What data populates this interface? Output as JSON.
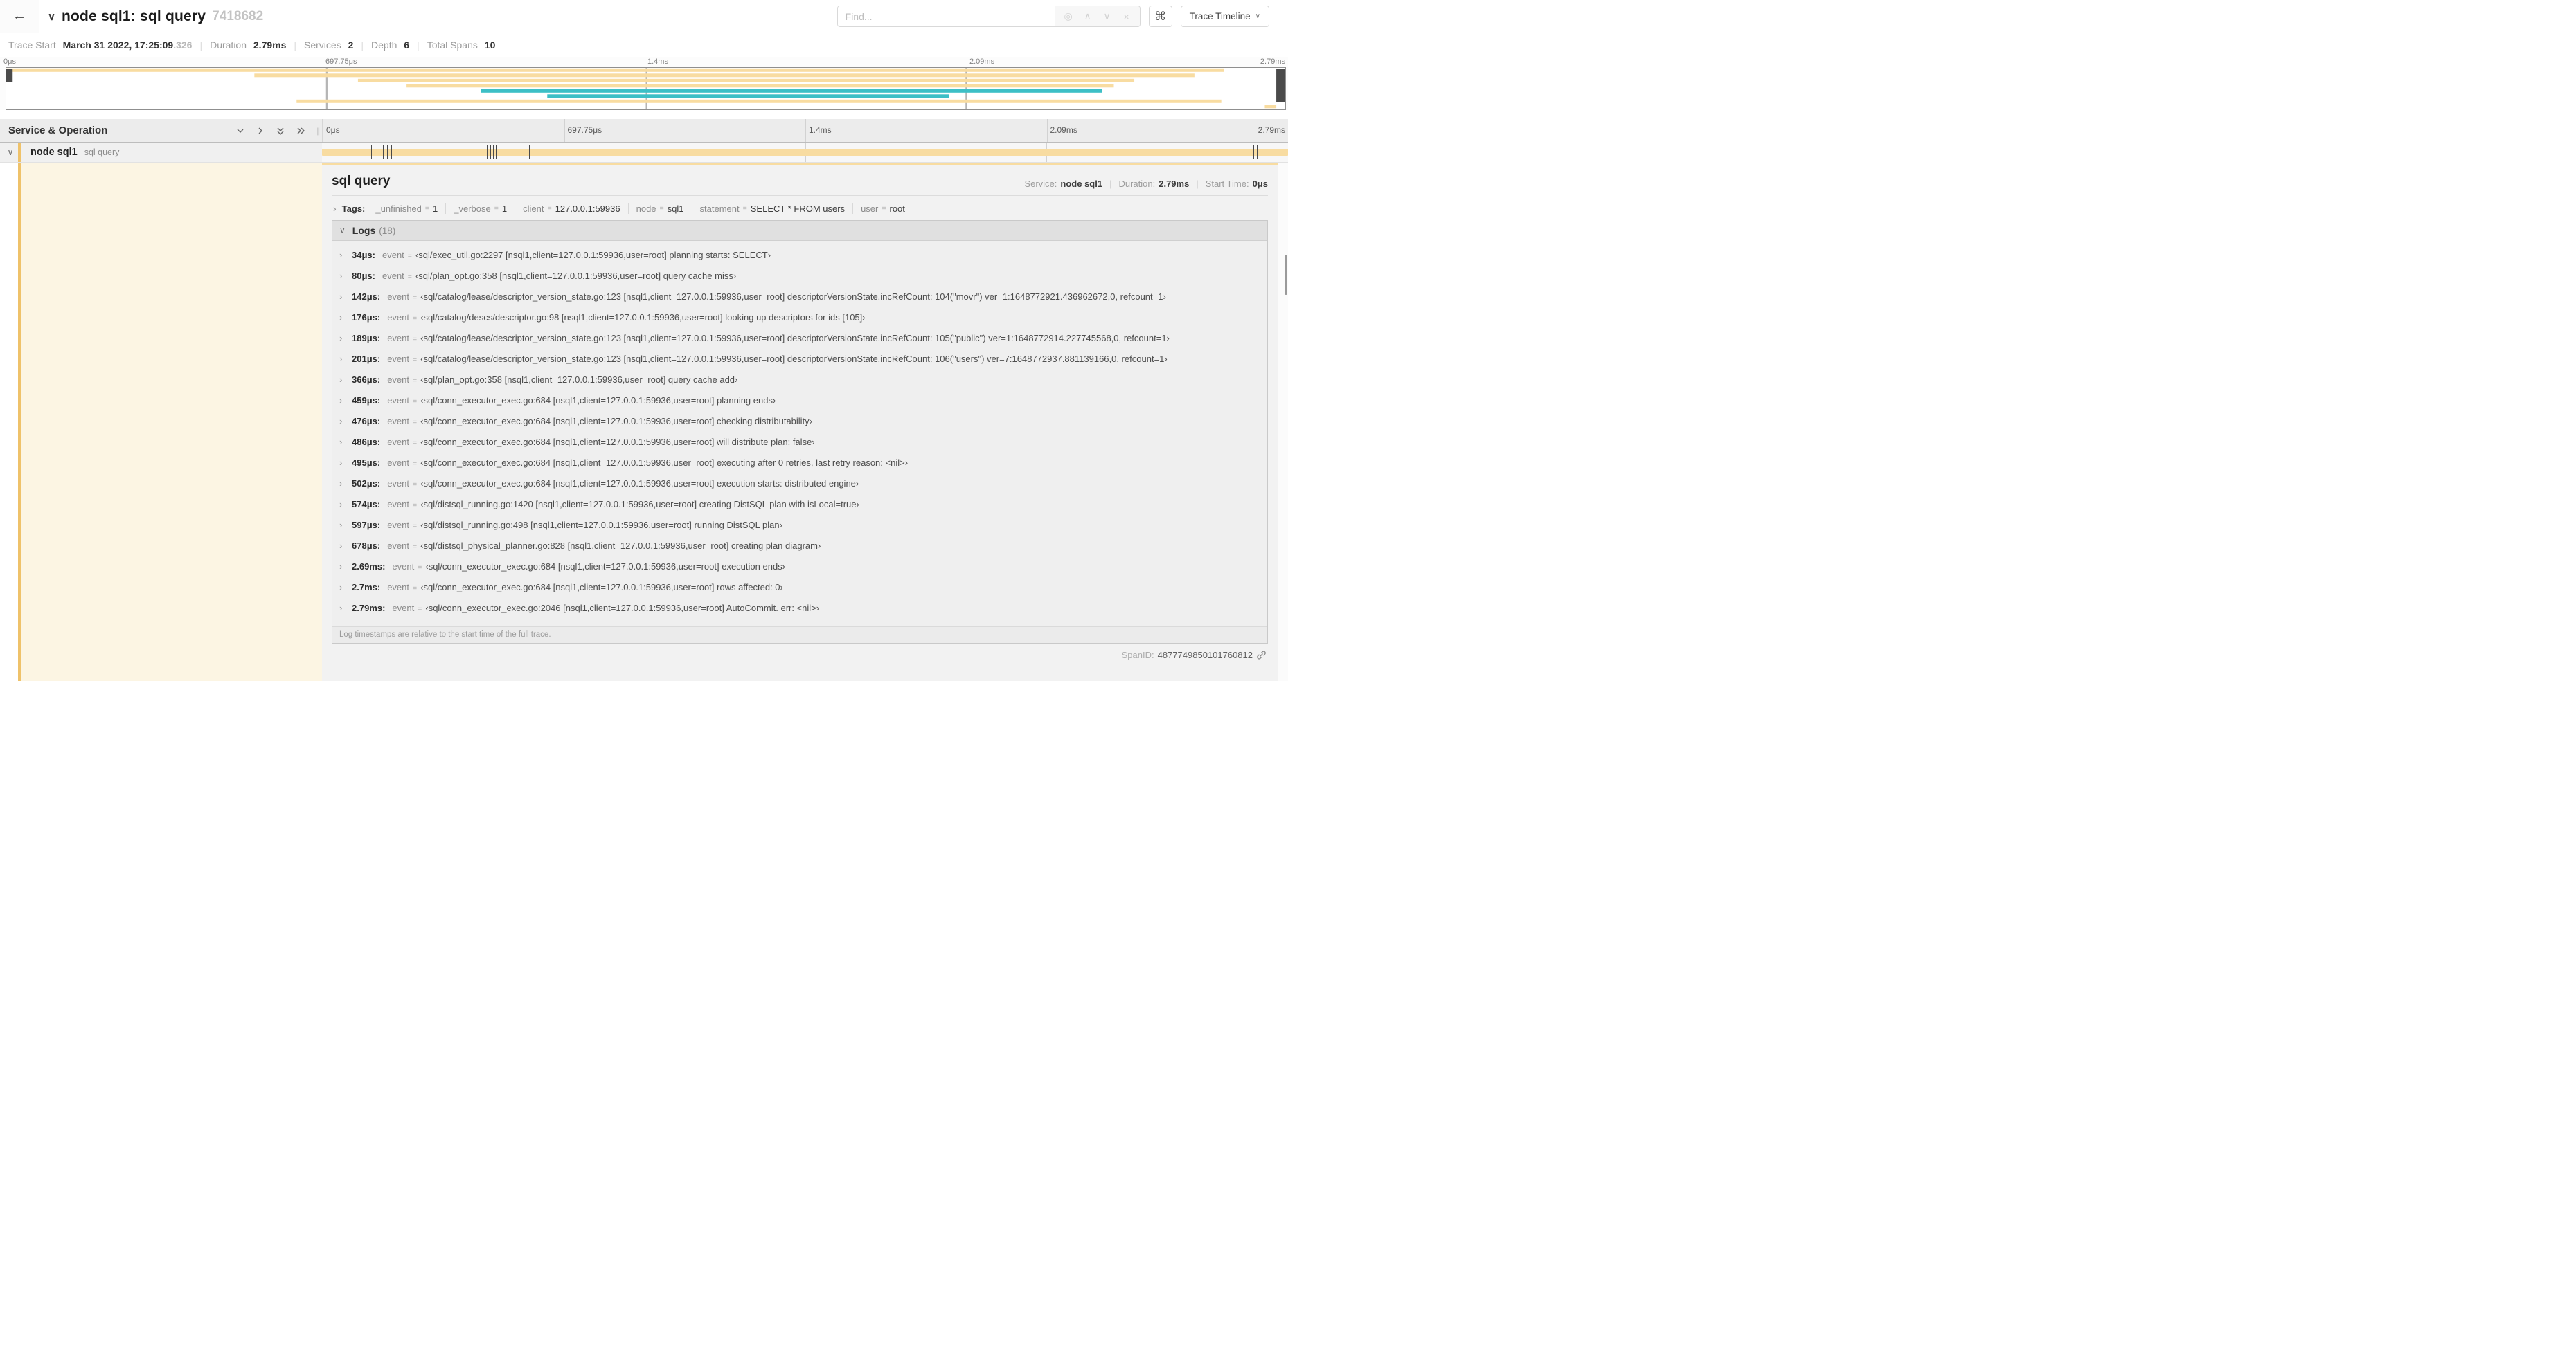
{
  "header": {
    "back_icon": "←",
    "collapse_icon": "∨",
    "title": "node sql1: sql query",
    "trace_id": "7418682",
    "search": {
      "placeholder": "Find..."
    },
    "search_buttons": {
      "target": "◎",
      "prev": "∧",
      "next": "∨",
      "clear": "×"
    },
    "shortcut_button": "⌘",
    "view_selector": {
      "label": "Trace Timeline",
      "caret": "∨"
    }
  },
  "trace_summary": {
    "items": [
      {
        "label": "Trace Start",
        "value": "March 31 2022, 17:25:09",
        "muted_suffix": ".326"
      },
      {
        "label": "Duration",
        "value": "2.79ms"
      },
      {
        "label": "Services",
        "value": "2"
      },
      {
        "label": "Depth",
        "value": "6"
      },
      {
        "label": "Total Spans",
        "value": "10"
      }
    ]
  },
  "colors": {
    "span_tan": "#F8DCA1",
    "span_strip": "#EFC26A",
    "span_teal": "#3DBFC6",
    "detail_cream": "#FCF5E3"
  },
  "minimap": {
    "ticks": [
      "0μs",
      "697.75μs",
      "1.4ms",
      "2.09ms",
      "2.79ms"
    ],
    "bars": [
      {
        "row": 0,
        "start_pct": 0,
        "end_pct": 95.2,
        "color": "tan"
      },
      {
        "row": 1,
        "start_pct": 19.4,
        "end_pct": 92.9,
        "color": "tan"
      },
      {
        "row": 2,
        "start_pct": 27.5,
        "end_pct": 88.2,
        "color": "tan"
      },
      {
        "row": 3,
        "start_pct": 31.3,
        "end_pct": 86.6,
        "color": "tan"
      },
      {
        "row": 4,
        "start_pct": 37.1,
        "end_pct": 85.7,
        "color": "teal"
      },
      {
        "row": 5,
        "start_pct": 42.3,
        "end_pct": 73.7,
        "color": "teal"
      },
      {
        "row": 6,
        "start_pct": 22.7,
        "end_pct": 95.0,
        "color": "tan"
      },
      {
        "row": 7,
        "start_pct": 98.4,
        "end_pct": 99.3,
        "color": "tan"
      }
    ]
  },
  "timeline": {
    "column_header": "Service & Operation",
    "resizer": "∥",
    "ticks": [
      "0μs",
      "697.75μs",
      "1.4ms",
      "2.09ms",
      "2.79ms"
    ],
    "row": {
      "collapse_icon": "∨",
      "service": "node sql1",
      "operation": "sql query",
      "bar_start_pct": 0,
      "bar_end_pct": 100,
      "log_marks_pct": [
        1.22,
        2.87,
        5.09,
        6.31,
        6.77,
        7.2,
        13.12,
        16.45,
        17.06,
        17.42,
        17.74,
        18.0,
        20.57,
        21.4,
        24.3,
        96.4,
        96.8,
        99.85
      ]
    }
  },
  "detail": {
    "title": "sql query",
    "overview": [
      {
        "label": "Service:",
        "value": "node sql1"
      },
      {
        "label": "Duration:",
        "value": "2.79ms"
      },
      {
        "label": "Start Time:",
        "value": "0μs"
      }
    ],
    "tags": {
      "expander": "›",
      "label": "Tags:",
      "items": [
        {
          "key": "_unfinished",
          "value": "1"
        },
        {
          "key": "_verbose",
          "value": "1"
        },
        {
          "key": "client",
          "value": "127.0.0.1:59936"
        },
        {
          "key": "node",
          "value": "sql1"
        },
        {
          "key": "statement",
          "value": "SELECT * FROM users"
        },
        {
          "key": "user",
          "value": "root"
        }
      ]
    },
    "logs": {
      "expander": "∨",
      "label": "Logs",
      "count": "(18)",
      "row_expander": "›",
      "field": "event",
      "rows": [
        {
          "ts": "34μs:",
          "value": "‹sql/exec_util.go:2297 [nsql1,client=127.0.0.1:59936,user=root] planning starts: SELECT›"
        },
        {
          "ts": "80μs:",
          "value": "‹sql/plan_opt.go:358 [nsql1,client=127.0.0.1:59936,user=root] query cache miss›"
        },
        {
          "ts": "142μs:",
          "value": "‹sql/catalog/lease/descriptor_version_state.go:123 [nsql1,client=127.0.0.1:59936,user=root] descriptorVersionState.incRefCount: 104(\"movr\") ver=1:1648772921.436962672,0, refcount=1›"
        },
        {
          "ts": "176μs:",
          "value": "‹sql/catalog/descs/descriptor.go:98 [nsql1,client=127.0.0.1:59936,user=root] looking up descriptors for ids [105]›"
        },
        {
          "ts": "189μs:",
          "value": "‹sql/catalog/lease/descriptor_version_state.go:123 [nsql1,client=127.0.0.1:59936,user=root] descriptorVersionState.incRefCount: 105(\"public\") ver=1:1648772914.227745568,0, refcount=1›"
        },
        {
          "ts": "201μs:",
          "value": "‹sql/catalog/lease/descriptor_version_state.go:123 [nsql1,client=127.0.0.1:59936,user=root] descriptorVersionState.incRefCount: 106(\"users\") ver=7:1648772937.881139166,0, refcount=1›"
        },
        {
          "ts": "366μs:",
          "value": "‹sql/plan_opt.go:358 [nsql1,client=127.0.0.1:59936,user=root] query cache add›"
        },
        {
          "ts": "459μs:",
          "value": "‹sql/conn_executor_exec.go:684 [nsql1,client=127.0.0.1:59936,user=root] planning ends›"
        },
        {
          "ts": "476μs:",
          "value": "‹sql/conn_executor_exec.go:684 [nsql1,client=127.0.0.1:59936,user=root] checking distributability›"
        },
        {
          "ts": "486μs:",
          "value": "‹sql/conn_executor_exec.go:684 [nsql1,client=127.0.0.1:59936,user=root] will distribute plan: false›"
        },
        {
          "ts": "495μs:",
          "value": "‹sql/conn_executor_exec.go:684 [nsql1,client=127.0.0.1:59936,user=root] executing after 0 retries, last retry reason: <nil>›"
        },
        {
          "ts": "502μs:",
          "value": "‹sql/conn_executor_exec.go:684 [nsql1,client=127.0.0.1:59936,user=root] execution starts: distributed engine›"
        },
        {
          "ts": "574μs:",
          "value": "‹sql/distsql_running.go:1420 [nsql1,client=127.0.0.1:59936,user=root] creating DistSQL plan with isLocal=true›"
        },
        {
          "ts": "597μs:",
          "value": "‹sql/distsql_running.go:498 [nsql1,client=127.0.0.1:59936,user=root] running DistSQL plan›"
        },
        {
          "ts": "678μs:",
          "value": "‹sql/distsql_physical_planner.go:828 [nsql1,client=127.0.0.1:59936,user=root] creating plan diagram›"
        },
        {
          "ts": "2.69ms:",
          "value": "‹sql/conn_executor_exec.go:684 [nsql1,client=127.0.0.1:59936,user=root] execution ends›"
        },
        {
          "ts": "2.7ms:",
          "value": "‹sql/conn_executor_exec.go:684 [nsql1,client=127.0.0.1:59936,user=root] rows affected: 0›"
        },
        {
          "ts": "2.79ms:",
          "value": "‹sql/conn_executor_exec.go:2046 [nsql1,client=127.0.0.1:59936,user=root] AutoCommit. err: <nil>›"
        }
      ],
      "footer": "Log timestamps are relative to the start time of the full trace."
    },
    "span_id_label": "SpanID:",
    "span_id": "4877749850101760812"
  }
}
